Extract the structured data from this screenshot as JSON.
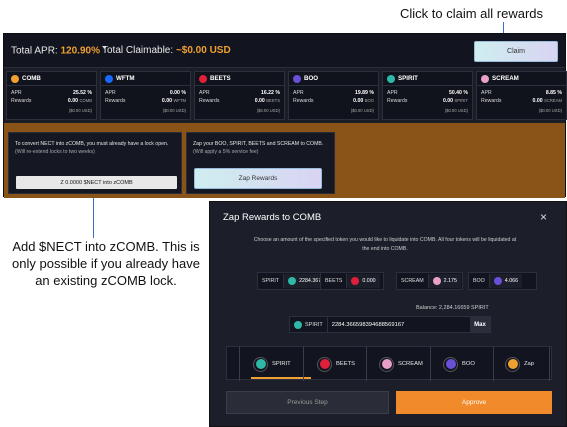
{
  "callouts": {
    "claim": "Click to claim all rewards",
    "nect": "Add $NECT into zCOMB. This is only possible if you already have an existing zCOMB lock."
  },
  "header": {
    "total_apr_label": "Total APR:",
    "total_apr_value": "120.90%",
    "total_claimable_label": "Total Claimable:",
    "total_claimable_value": "~$0.00 USD",
    "claim_label": "Claim"
  },
  "tiles": [
    {
      "name": "COMB",
      "apr_label": "APR",
      "apr": "25.52 %",
      "rewards_label": "Rewards",
      "rewards": "0.00",
      "unit": "COMB",
      "usd": "($0.00 USD)",
      "color": "#f0a030"
    },
    {
      "name": "WFTM",
      "apr_label": "APR",
      "apr": "0.00 %",
      "rewards_label": "Rewards",
      "rewards": "0.00",
      "unit": "WFTM",
      "usd": "($0.00 USD)",
      "color": "#1969ff"
    },
    {
      "name": "BEETS",
      "apr_label": "APR",
      "apr": "16.22 %",
      "rewards_label": "Rewards",
      "rewards": "0.00",
      "unit": "BEETS",
      "usd": "($0.00 USD)",
      "color": "#e0203a"
    },
    {
      "name": "BOO",
      "apr_label": "APR",
      "apr": "19.89 %",
      "rewards_label": "Rewards",
      "rewards": "0.00",
      "unit": "BOO",
      "usd": "($0.00 USD)",
      "color": "#6a4fd8"
    },
    {
      "name": "SPIRIT",
      "apr_label": "APR",
      "apr": "50.40 %",
      "rewards_label": "Rewards",
      "rewards": "0.00",
      "unit": "SPIRIT",
      "usd": "($0.00 USD)",
      "color": "#2fb8a8"
    },
    {
      "name": "SCREAM",
      "apr_label": "APR",
      "apr": "8.85 %",
      "rewards_label": "Rewards",
      "rewards": "0.00",
      "unit": "SCREAM",
      "usd": "($0.00 USD)",
      "color": "#e8a0c8"
    }
  ],
  "nect_card": {
    "line1": "To convert NECT into zCOMB, you must already have a lock open.",
    "line2": "(Will re-extend locks to two weeks)",
    "button": "Z 0.0000 $NECT into zCOMB"
  },
  "zap_card": {
    "line1": "Zap your BOO, SPIRIT, BEETS and SCREAM to COMB.",
    "line2": "(Will apply a 5% service fee)",
    "button": "Zap Rewards"
  },
  "modal": {
    "title": "Zap Rewards to COMB",
    "close": "×",
    "description": "Choose an amount of the specified token you would like to liquidate into COMB. All four tokens will be liquidated at the end into COMB.",
    "balances": [
      {
        "token": "SPIRIT",
        "amount": "2284.367",
        "color": "#2fb8a8"
      },
      {
        "token": "BEETS",
        "amount": "0.000",
        "color": "#e0203a"
      },
      {
        "token": "SCREAM",
        "amount": "2.175",
        "color": "#e8a0c8"
      },
      {
        "token": "BOO",
        "amount": "4.066",
        "color": "#6a4fd8"
      }
    ],
    "balance_line": "Balance: 2,284.16659 SPIRIT",
    "input_token": "SPIRIT",
    "input_value": "2284.366598394688569167",
    "max_label": "Max",
    "steps": [
      "SPIRIT",
      "BEETS",
      "SCREAM",
      "BOO",
      "Zap"
    ],
    "previous_label": "Previous Step",
    "approve_label": "Approve"
  }
}
